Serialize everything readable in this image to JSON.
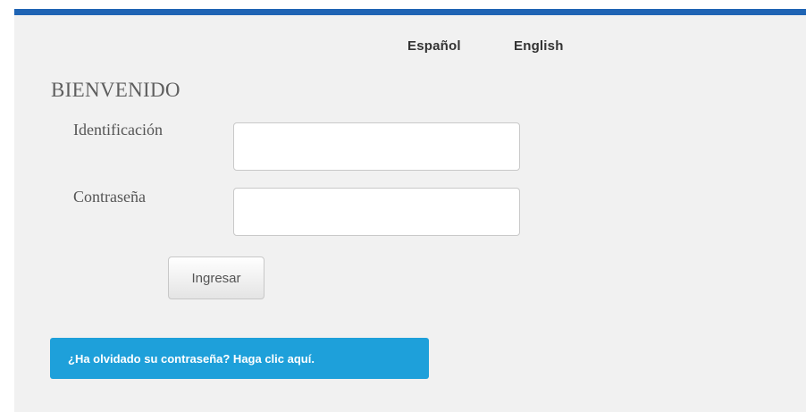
{
  "language_switch": {
    "spanish": "Español",
    "english": "English"
  },
  "login": {
    "title": "BIENVENIDO",
    "id_label": "Identificación",
    "id_value": "",
    "password_label": "Contraseña",
    "password_value": "",
    "submit_label": "Ingresar",
    "forgot_label": "¿Ha olvidado su contraseña? Haga clic aquí."
  },
  "colors": {
    "top_bar": "#1f64b4",
    "forgot_button": "#1ea0da",
    "panel_background": "#f1f1f1"
  }
}
